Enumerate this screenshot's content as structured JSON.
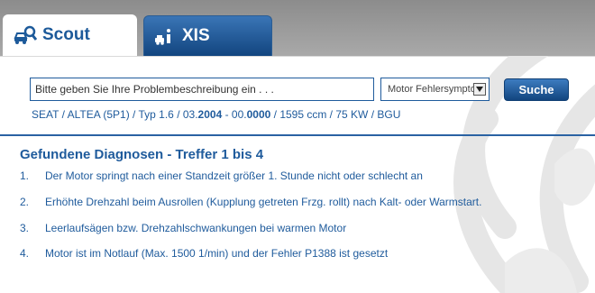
{
  "tabs": [
    {
      "label": "Scout",
      "icon": "car-search-icon",
      "active": true
    },
    {
      "label": "XIS",
      "icon": "car-info-icon",
      "active": false
    }
  ],
  "search": {
    "value": "Bitte geben Sie Ihre Problembeschreibung ein . . .",
    "select_value": "Motor Fehlersymptom",
    "button_label": "Suche"
  },
  "vehicle": {
    "prefix": "SEAT / ALTEA (5P1) / Typ 1.6 / 03.",
    "year_from": "2004",
    "dash": " - 00.",
    "year_to": "0000",
    "suffix": " / 1595 ccm / 75 KW / BGU"
  },
  "results": {
    "heading": "Gefundene Diagnosen - Treffer 1 bis 4",
    "items": [
      {
        "num": "1.",
        "text": "Der Motor springt nach einer Standzeit größer 1. Stunde nicht oder schlecht an"
      },
      {
        "num": "2.",
        "text": "Erhöhte Drehzahl beim Ausrollen (Kupplung getreten Frzg. rollt) nach Kalt- oder Warmstart."
      },
      {
        "num": "3.",
        "text": "Leerlaufsägen bzw. Drehzahlschwankungen bei warmen Motor"
      },
      {
        "num": "4.",
        "text": "Motor ist im Notlauf (Max. 1500 1/min) und der Fehler P1388 ist gesetzt"
      }
    ]
  },
  "colors": {
    "accent": "#1f5b9c",
    "tab_active_bg": "#ffffff",
    "tab_inactive_bg": "#1d5696",
    "topbar": "#999999"
  }
}
